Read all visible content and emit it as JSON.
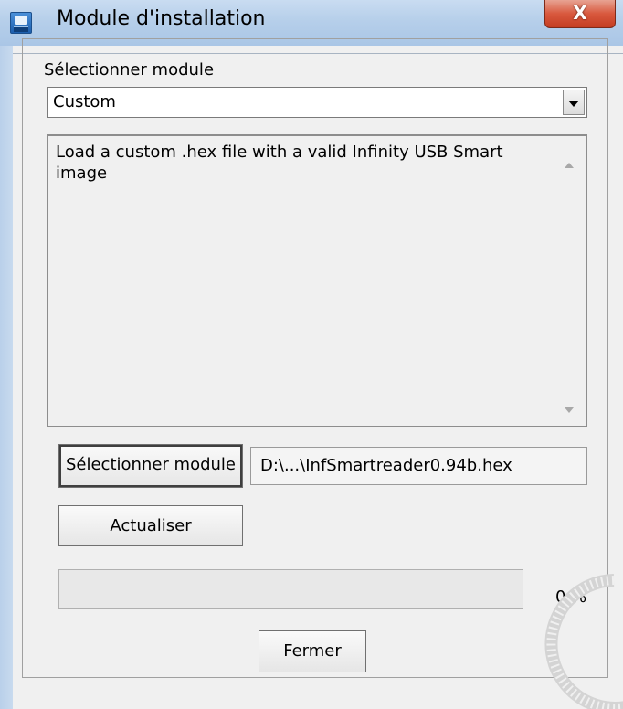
{
  "window": {
    "title": "Module d'installation",
    "close_label": "X",
    "icon": "usb-installer-icon"
  },
  "form": {
    "select_label": "Sélectionner module",
    "module_dropdown": {
      "selected": "Custom"
    },
    "description": "Load a custom .hex file with a valid Infinity USB Smart image",
    "select_button_label": "Sélectionner module",
    "file_path": "D:\\...\\InfSmartreader0.94b.hex",
    "refresh_button_label": "Actualiser",
    "progress": {
      "value": 0,
      "label": "0 %"
    },
    "close_button_label": "Fermer"
  },
  "colors": {
    "titlebar": "#b6cfea",
    "close_button": "#d9593e",
    "window_bg": "#f0f0f0"
  }
}
